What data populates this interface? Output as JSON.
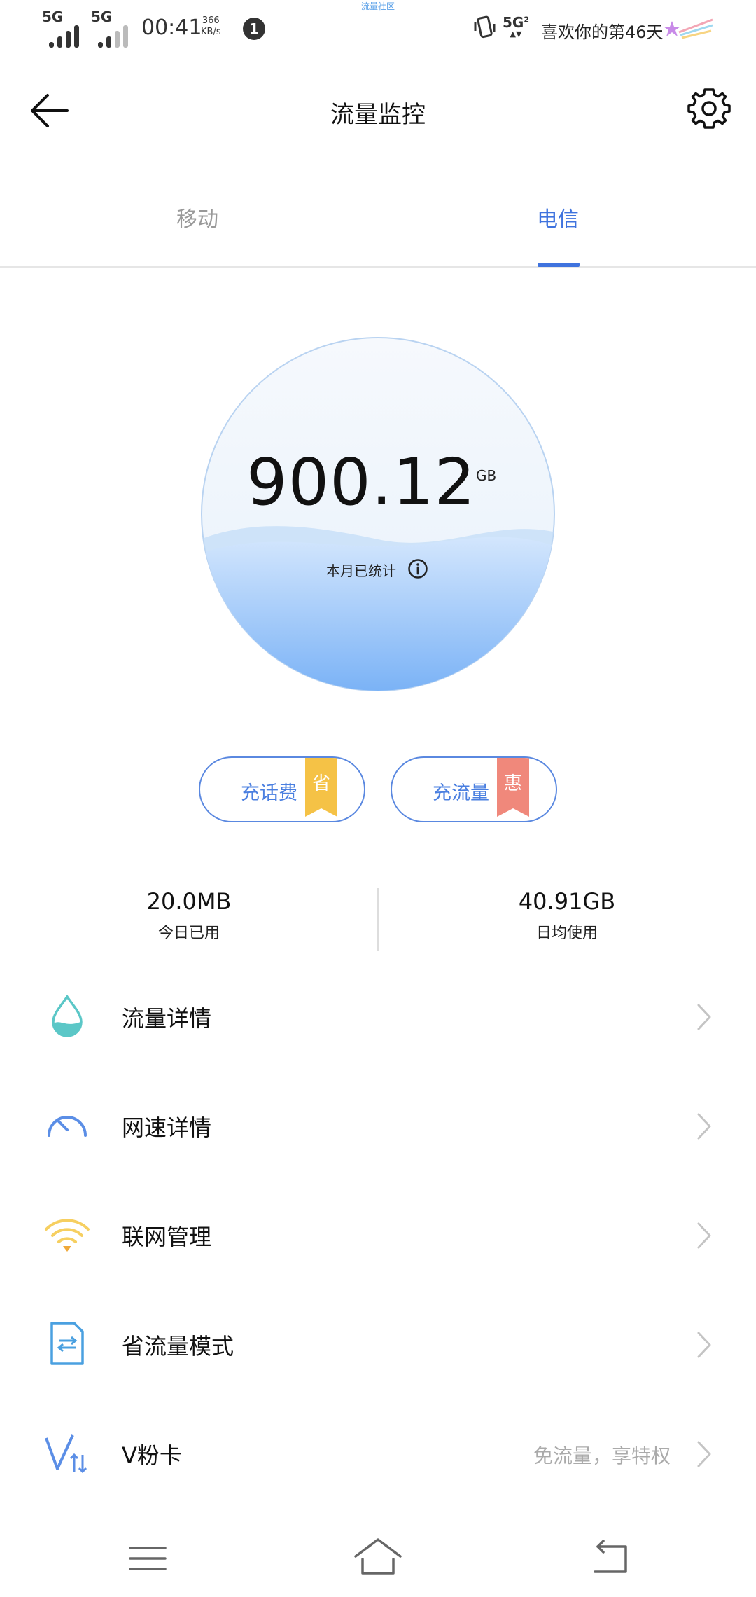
{
  "status_bar": {
    "sim1_network": "5G",
    "sim2_network": "5G",
    "time": "00:41",
    "speed_value": "366",
    "speed_unit": "KB/s",
    "notification_count": "1",
    "top_center_text": "流量社区",
    "right_network": "5G",
    "right_network_sub": "2",
    "message": "喜欢你的第46天"
  },
  "header": {
    "title": "流量监控",
    "back_icon": "arrow-left-icon",
    "settings_icon": "gear-icon"
  },
  "tabs": [
    {
      "label": "移动",
      "active": false
    },
    {
      "label": "电信",
      "active": true
    }
  ],
  "usage": {
    "value": "900.12",
    "unit": "GB",
    "caption": "本月已统计",
    "info_icon": "info-icon"
  },
  "recharge": {
    "phone_label": "充话费",
    "phone_badge": "省",
    "data_label": "充流量",
    "data_badge": "惠"
  },
  "stats": {
    "today_value": "20.0MB",
    "today_label": "今日已用",
    "daily_avg_value": "40.91GB",
    "daily_avg_label": "日均使用"
  },
  "menu": [
    {
      "label": "流量详情",
      "icon": "water-drop-icon",
      "extra": ""
    },
    {
      "label": "网速详情",
      "icon": "speedometer-icon",
      "extra": ""
    },
    {
      "label": "联网管理",
      "icon": "wifi-icon",
      "extra": ""
    },
    {
      "label": "省流量模式",
      "icon": "data-saver-icon",
      "extra": ""
    },
    {
      "label": "V粉卡",
      "icon": "v-card-icon",
      "extra": "免流量，享特权"
    }
  ],
  "nav_bar": {
    "menu_icon": "menu-icon",
    "home_icon": "home-icon",
    "back_icon": "back-icon"
  },
  "colors": {
    "accent": "#3f73de",
    "badge_save": "#f5c246",
    "badge_discount": "#f0887b",
    "water": "#7fb6f5"
  }
}
